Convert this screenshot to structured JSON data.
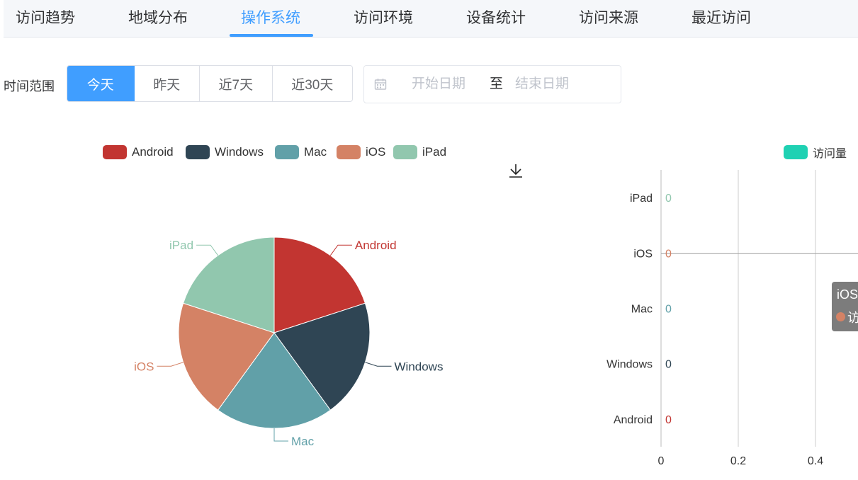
{
  "tabs": [
    {
      "label": "访问趋势",
      "active": false
    },
    {
      "label": "地域分布",
      "active": false
    },
    {
      "label": "操作系统",
      "active": true
    },
    {
      "label": "访问环境",
      "active": false
    },
    {
      "label": "设备统计",
      "active": false
    },
    {
      "label": "访问来源",
      "active": false
    },
    {
      "label": "最近访问",
      "active": false
    }
  ],
  "filter": {
    "label": "时间范围",
    "ranges": [
      {
        "label": "今天",
        "active": true
      },
      {
        "label": "昨天",
        "active": false
      },
      {
        "label": "近7天",
        "active": false
      },
      {
        "label": "近30天",
        "active": false
      }
    ],
    "date_start_placeholder": "开始日期",
    "date_separator": "至",
    "date_end_placeholder": "结束日期"
  },
  "colors": {
    "accent": "#409eff",
    "Android": "#c23531",
    "Windows": "#2f4554",
    "Mac": "#61a0a8",
    "iOS": "#d48265",
    "iPad": "#91c7ae",
    "visits": "#1fd1b3"
  },
  "chart_data": [
    {
      "type": "pie",
      "legend": [
        "Android",
        "Windows",
        "Mac",
        "iOS",
        "iPad"
      ],
      "legend_position": "top",
      "slices": [
        {
          "name": "Android",
          "value": 1
        },
        {
          "name": "Windows",
          "value": 1
        },
        {
          "name": "Mac",
          "value": 1
        },
        {
          "name": "iOS",
          "value": 1
        },
        {
          "name": "iPad",
          "value": 1
        }
      ],
      "toolbox": "download-icon"
    },
    {
      "type": "bar",
      "orientation": "horizontal",
      "categories": [
        "Android",
        "Windows",
        "Mac",
        "iOS",
        "iPad"
      ],
      "series": [
        {
          "name": "访问量",
          "values": [
            0,
            0,
            0,
            0,
            0
          ]
        }
      ],
      "x_ticks": [
        "0",
        "0.2",
        "0.4"
      ],
      "xlim": [
        0,
        0.4
      ],
      "legend_position": "top-right",
      "hover_category": "iOS",
      "tooltip": {
        "title": "iOS",
        "series_text": "访"
      }
    }
  ]
}
